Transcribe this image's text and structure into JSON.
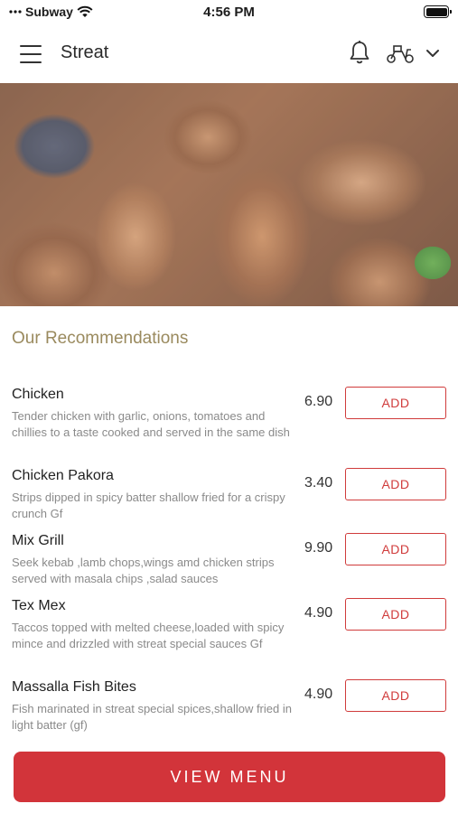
{
  "status_bar": {
    "carrier": "Subway",
    "time": "4:56 PM"
  },
  "header": {
    "title": "Streat",
    "icons": [
      "hamburger-menu-icon",
      "bell-icon",
      "scooter-delivery-icon",
      "chevron-down-icon"
    ]
  },
  "recommendations": {
    "title": "Our Recommendations",
    "add_label": "ADD",
    "items": [
      {
        "name": "Chicken",
        "description": "Tender chicken with garlic, onions, tomatoes and chillies to a taste cooked and served in the same dish",
        "price": "6.90"
      },
      {
        "name": "Chicken Pakora",
        "description": "Strips dipped in spicy batter shallow fried for a crispy crunch Gf",
        "price": "3.40"
      },
      {
        "name": "Mix Grill",
        "description": "Seek kebab ,lamb chops,wings amd chicken strips served with masala chips ,salad sauces",
        "price": "9.90"
      },
      {
        "name": "Tex Mex",
        "description": "Taccos topped with melted cheese,loaded with spicy mince and drizzled with streat special sauces Gf",
        "price": "4.90"
      },
      {
        "name": "Massalla Fish Bites",
        "description": "Fish marinated in streat special spices,shallow fried in light batter  (gf)",
        "price": "4.90"
      }
    ]
  },
  "footer": {
    "view_menu_label": "VIEW MENU"
  },
  "colors": {
    "accent": "#d2343a",
    "section_title": "#9a8a5e"
  }
}
